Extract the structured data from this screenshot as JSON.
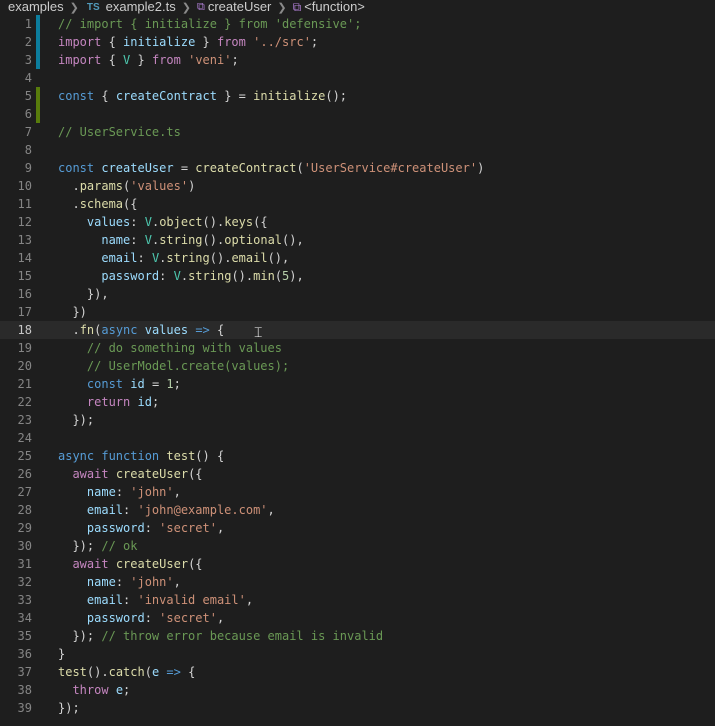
{
  "breadcrumb": {
    "folder": "examples",
    "file_badge": "TS",
    "file": "example2.ts",
    "symbol": "createUser",
    "function": "<function>"
  },
  "editor": {
    "current_line": 18,
    "lines": [
      {
        "num": "1",
        "text": "// import { initialize } from 'defensive';"
      },
      {
        "num": "2",
        "text": "import { initialize } from '../src';"
      },
      {
        "num": "3",
        "text": "import { V } from 'veni';"
      },
      {
        "num": "4",
        "text": ""
      },
      {
        "num": "5",
        "text": "const { createContract } = initialize();"
      },
      {
        "num": "6",
        "text": ""
      },
      {
        "num": "7",
        "text": "// UserService.ts"
      },
      {
        "num": "8",
        "text": ""
      },
      {
        "num": "9",
        "text": "const createUser = createContract('UserService#createUser')"
      },
      {
        "num": "10",
        "text": "  .params('values')"
      },
      {
        "num": "11",
        "text": "  .schema({"
      },
      {
        "num": "12",
        "text": "    values: V.object().keys({"
      },
      {
        "num": "13",
        "text": "      name: V.string().optional(),"
      },
      {
        "num": "14",
        "text": "      email: V.string().email(),"
      },
      {
        "num": "15",
        "text": "      password: V.string().min(5),"
      },
      {
        "num": "16",
        "text": "    }),"
      },
      {
        "num": "17",
        "text": "  })"
      },
      {
        "num": "18",
        "text": "  .fn(async values => {"
      },
      {
        "num": "19",
        "text": "    // do something with values"
      },
      {
        "num": "20",
        "text": "    // UserModel.create(values);"
      },
      {
        "num": "21",
        "text": "    const id = 1;"
      },
      {
        "num": "22",
        "text": "    return id;"
      },
      {
        "num": "23",
        "text": "  });"
      },
      {
        "num": "24",
        "text": ""
      },
      {
        "num": "25",
        "text": "async function test() {"
      },
      {
        "num": "26",
        "text": "  await createUser({"
      },
      {
        "num": "27",
        "text": "    name: 'john',"
      },
      {
        "num": "28",
        "text": "    email: 'john@example.com',"
      },
      {
        "num": "29",
        "text": "    password: 'secret',"
      },
      {
        "num": "30",
        "text": "  }); // ok"
      },
      {
        "num": "31",
        "text": "  await createUser({"
      },
      {
        "num": "32",
        "text": "    name: 'john',"
      },
      {
        "num": "33",
        "text": "    email: 'invalid email',"
      },
      {
        "num": "34",
        "text": "    password: 'secret',"
      },
      {
        "num": "35",
        "text": "  }); // throw error because email is invalid"
      },
      {
        "num": "36",
        "text": "}"
      },
      {
        "num": "37",
        "text": "test().catch(e => {"
      },
      {
        "num": "38",
        "text": "  throw e;"
      },
      {
        "num": "39",
        "text": "});"
      }
    ]
  },
  "colors": {
    "background": "#1e1e1e",
    "keyword": "#569cd6",
    "control": "#c586c0",
    "string": "#ce9178",
    "comment": "#6a9955",
    "function": "#dcdcaa",
    "variable": "#9cdcfe",
    "class": "#4ec9b0",
    "number": "#b5cea8",
    "gutter_modified": "#0c7d9d",
    "gutter_added": "#587c0c"
  },
  "icons": {
    "breadcrumb_separator": "chevron-right-icon",
    "symbol": "cube-icon",
    "cursor": "text-cursor-icon"
  }
}
